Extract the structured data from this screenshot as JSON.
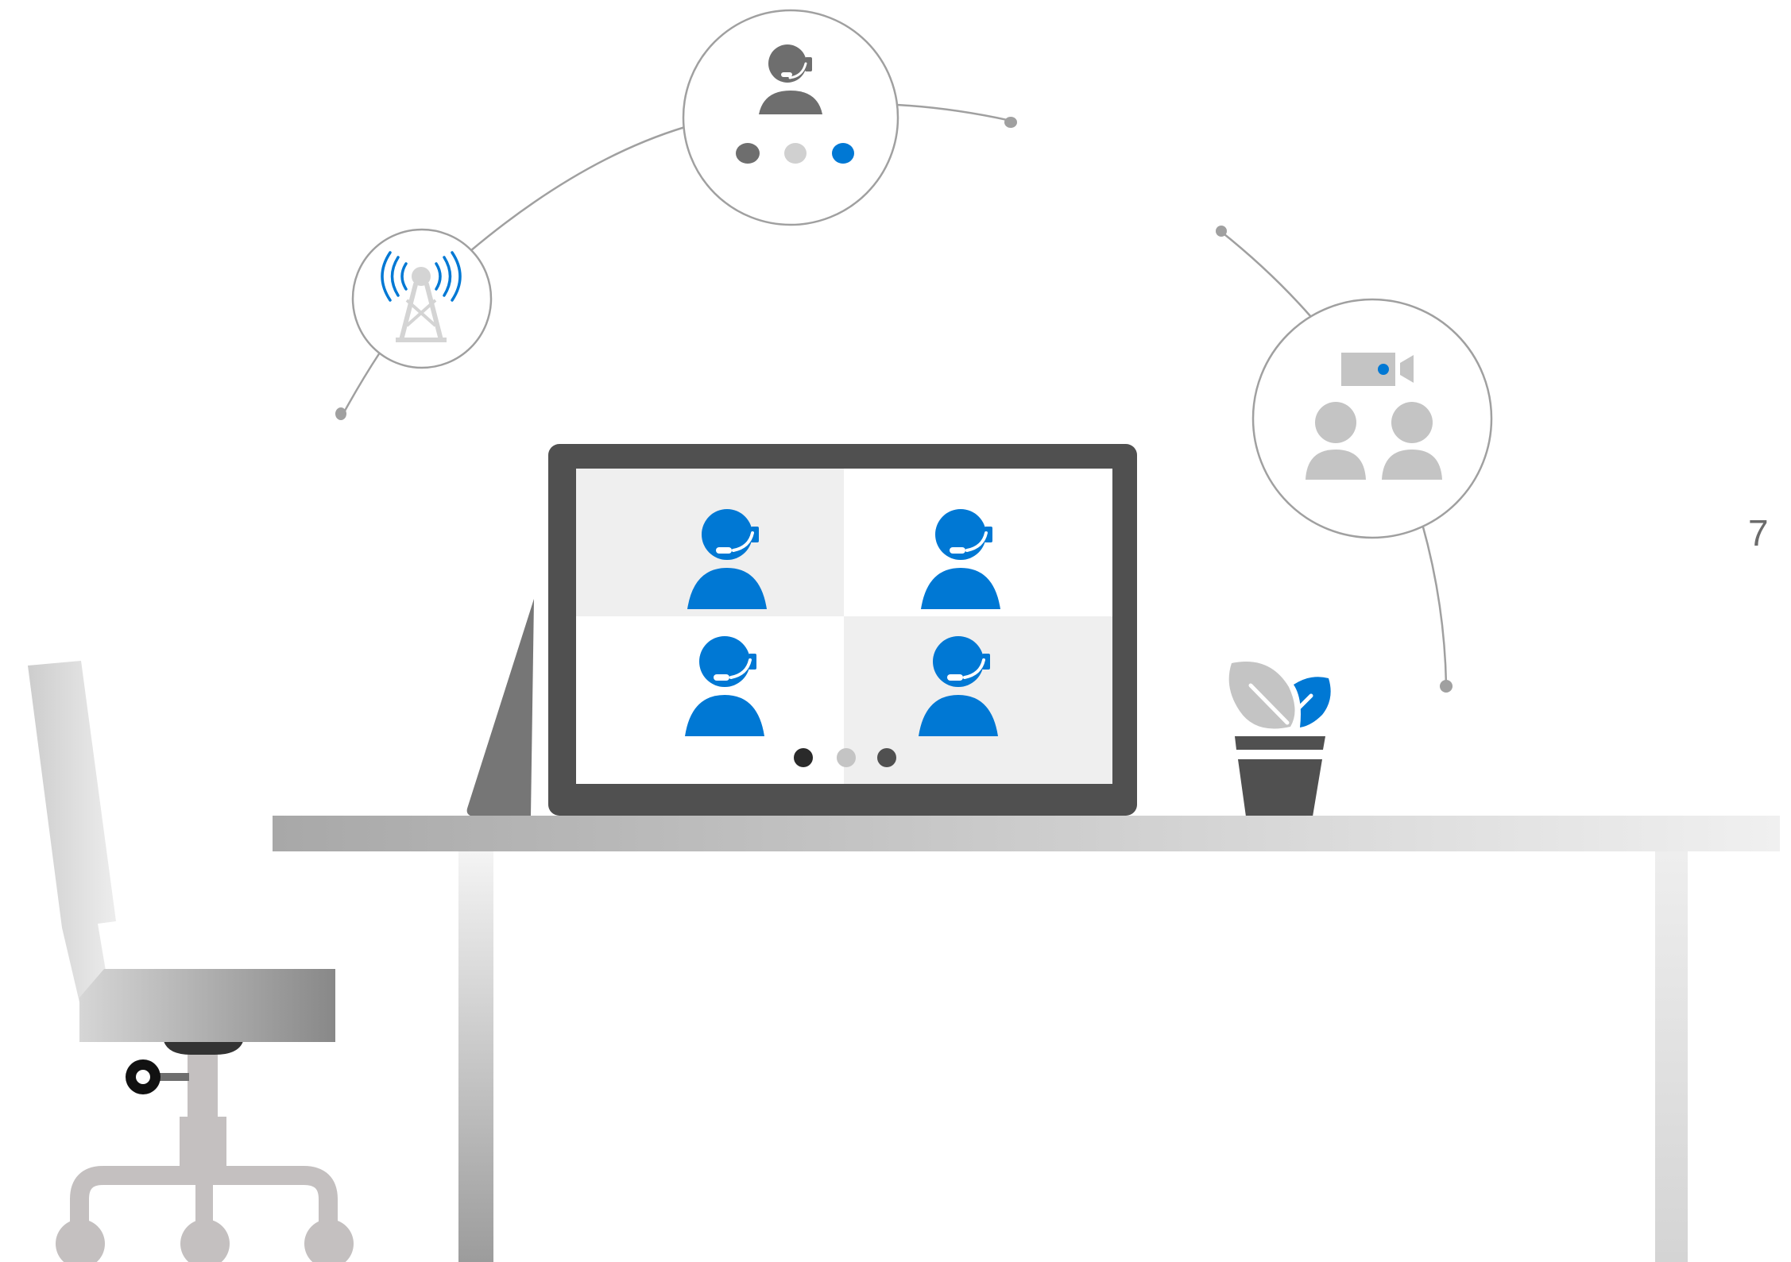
{
  "page_number": "7",
  "colors": {
    "accent_blue": "#0078D4",
    "dark_gray": "#505050",
    "mid_gray": "#767676",
    "light_gray": "#C4C4C4",
    "line_gray": "#A0A0A0",
    "screen_tile_gray": "#EFEFEF"
  },
  "icons": {
    "cell_tower": "cell-tower-icon",
    "support_agent": "support-agent-icon",
    "meeting_room": "meeting-room-icon",
    "video_camera": "video-camera-icon",
    "plant": "plant-icon"
  },
  "screen": {
    "participants": 4,
    "pager_dots": 3
  }
}
